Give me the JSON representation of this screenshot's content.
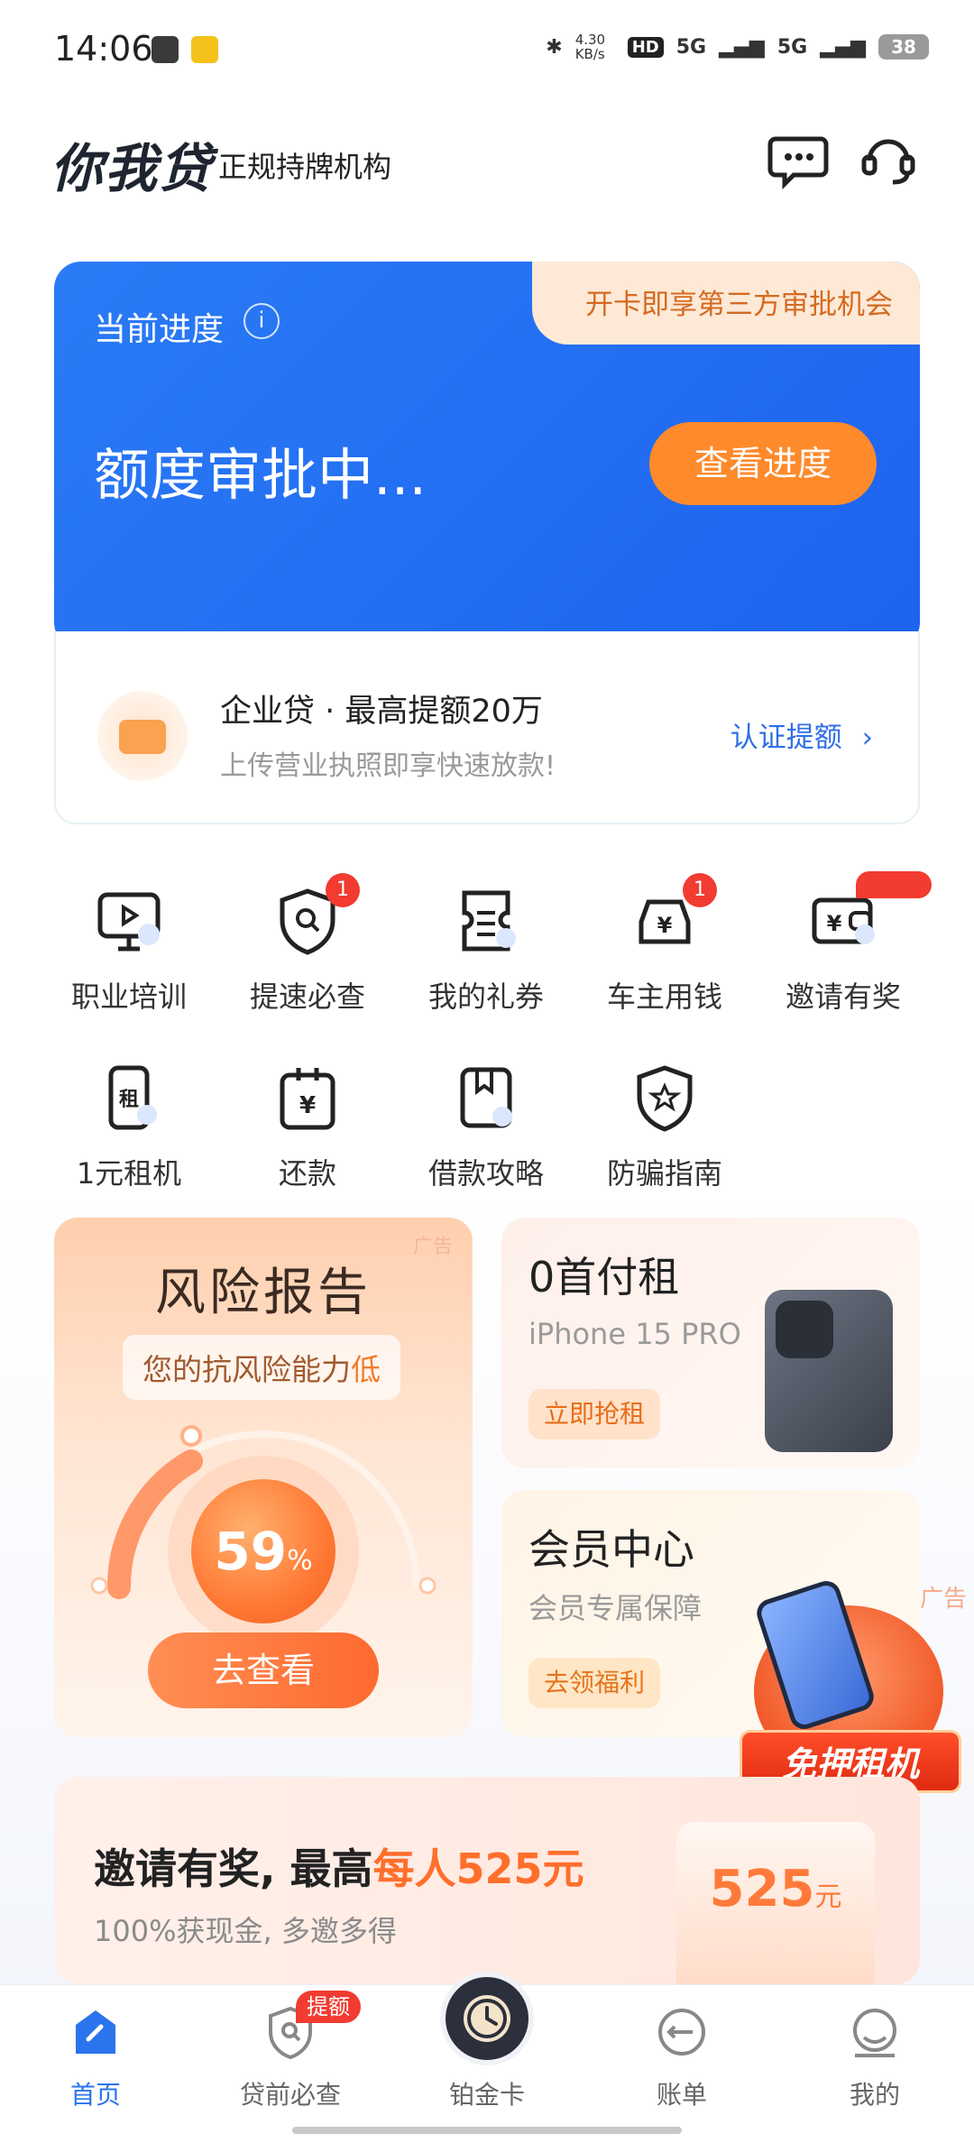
{
  "status_bar": {
    "time": "14:06",
    "net_speed": "4.30 KB/s",
    "hd": "HD",
    "signal1": "5G",
    "signal2": "5G",
    "battery": "38"
  },
  "header": {
    "logo": "你我贷",
    "subtitle": "正规持牌机构"
  },
  "progress_card": {
    "label": "当前进度",
    "status": "额度审批中...",
    "button": "查看进度",
    "promo": "开卡即享第三方审批机会"
  },
  "enterprise_card": {
    "title": "企业贷 · 最高提额20万",
    "subtitle": "上传营业执照即享快速放款!",
    "link": "认证提额"
  },
  "grid": [
    {
      "label": "职业培训",
      "badge": ""
    },
    {
      "label": "提速必查",
      "badge": "1"
    },
    {
      "label": "我的礼券",
      "badge": ""
    },
    {
      "label": "车主用钱",
      "badge": "1"
    },
    {
      "label": "邀请有奖",
      "badge": ""
    },
    {
      "label": "1元租机",
      "badge": ""
    },
    {
      "label": "还款",
      "badge": ""
    },
    {
      "label": "借款攻略",
      "badge": ""
    },
    {
      "label": "防骗指南",
      "badge": ""
    }
  ],
  "risk_card": {
    "ad": "广告",
    "title": "风险报告",
    "sub_prefix": "您的抗风险能力",
    "sub_level": "低",
    "percent": "59",
    "percent_unit": "%",
    "button": "去查看"
  },
  "rent_card": {
    "title": "0首付租",
    "subtitle": "iPhone 15 PRO",
    "button": "立即抢租"
  },
  "vip_card": {
    "title": "会员中心",
    "subtitle": "会员专属保障",
    "button": "去领福利",
    "ad": "广告"
  },
  "float_promo": {
    "label": "免押租机"
  },
  "invite_card": {
    "title_prefix": "邀请有奖, 最高",
    "title_highlight": "每人525元",
    "subtitle": "100%获现金, 多邀多得",
    "amount": "525",
    "amount_unit": "元"
  },
  "bottom_nav": {
    "items": [
      {
        "label": "首页"
      },
      {
        "label": "贷前必查",
        "badge": "提额"
      },
      {
        "label": "铂金卡"
      },
      {
        "label": "账单"
      },
      {
        "label": "我的"
      }
    ]
  },
  "colors": {
    "brand_blue": "#1d63ee",
    "accent_orange": "#ff8a2b",
    "badge_red": "#f23b31"
  }
}
